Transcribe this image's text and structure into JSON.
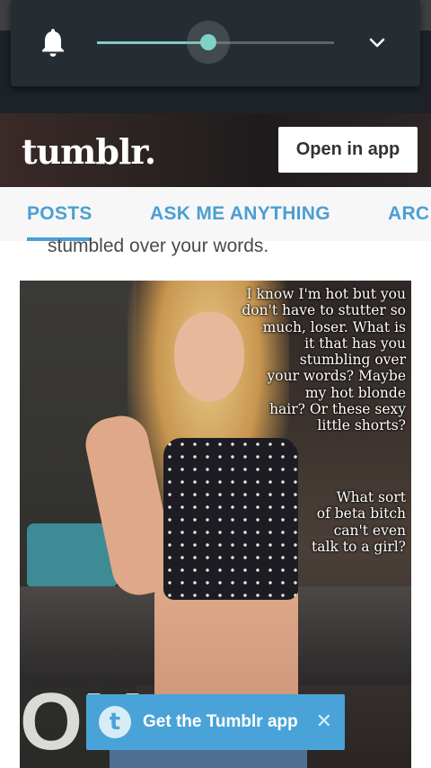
{
  "volume_overlay": {
    "ringer_icon": "bell-icon",
    "level_fraction": 0.47,
    "expand_icon": "chevron-down-icon",
    "accent_color": "#80d2c6"
  },
  "header": {
    "logo_text": "tumblr.",
    "open_app_label": "Open in app"
  },
  "tabs": [
    {
      "label": "POSTS",
      "active": true
    },
    {
      "label": "ASK ME ANYTHING",
      "active": false
    },
    {
      "label": "ARC",
      "active": false
    }
  ],
  "post": {
    "caption_tail": "stumbled over your words.",
    "image_quote_1": "I know I'm hot but you\ndon't have to stutter so\nmuch, loser. What is\nit that has you\nstumbling over\nyour words? Maybe\nmy hot blonde\nhair? Or these sexy\nlittle shorts?",
    "image_quote_2": "What sort\nof beta bitch\ncan't even\ntalk to a girl?",
    "background_letters": "OY"
  },
  "app_banner": {
    "badge_letter": "t",
    "label": "Get the Tumblr app",
    "close_glyph": "✕",
    "color": "#4aa3d8"
  },
  "colors": {
    "link_blue": "#4a9fd3"
  }
}
